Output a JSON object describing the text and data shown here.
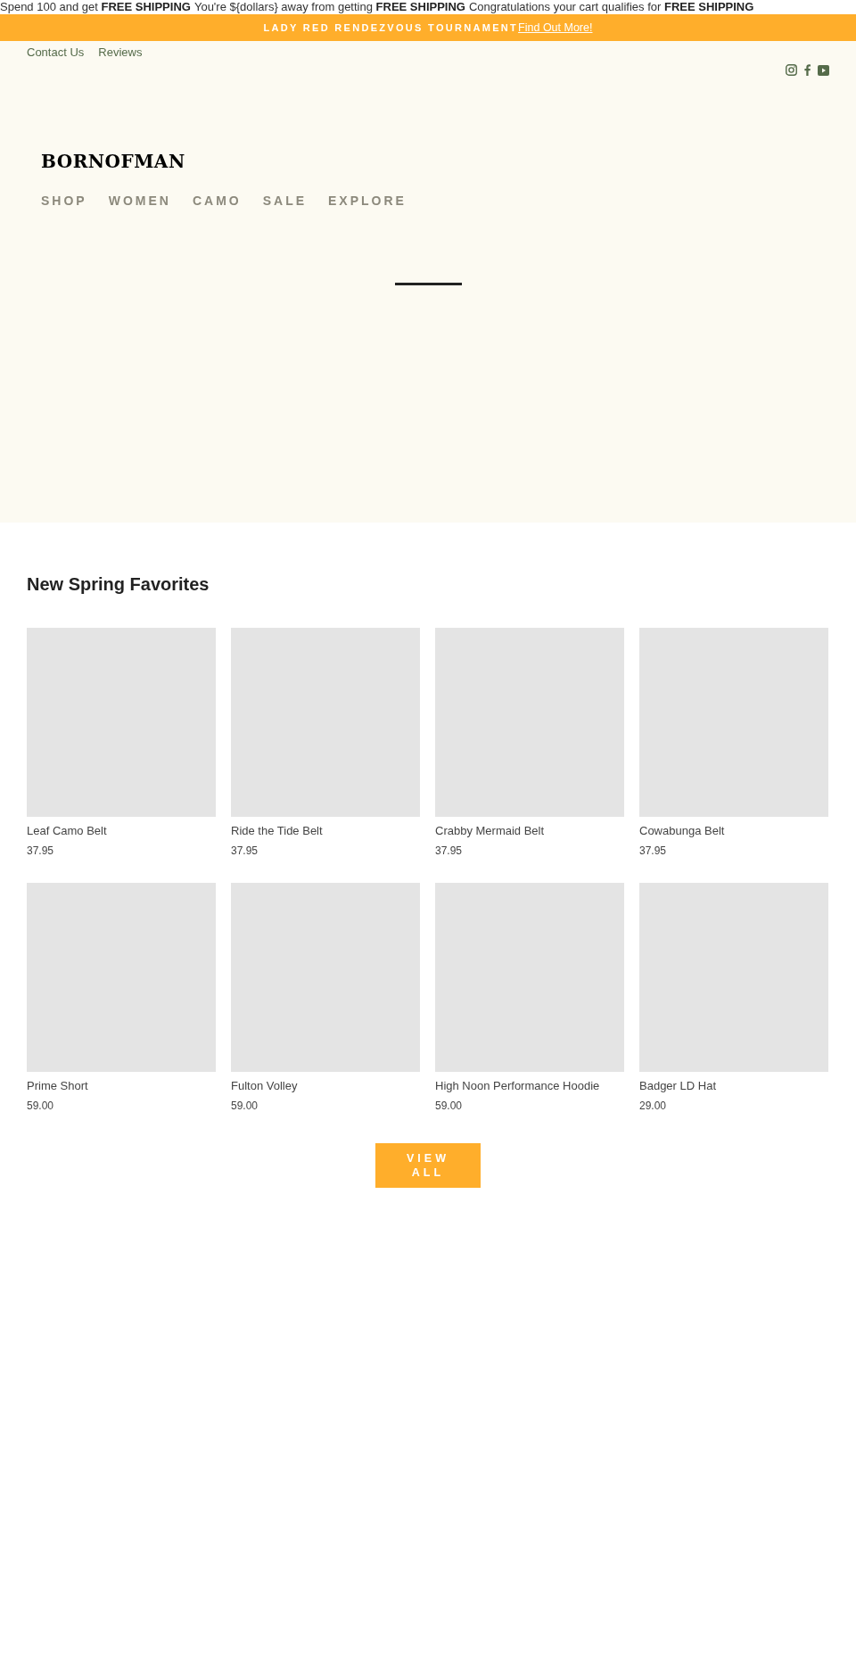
{
  "shipping_messages": [
    "Spend 100 and get **FREE SHIPPING**",
    "You're ${dollars} away from getting **FREE SHIPPING**",
    "Congratulations your cart qualifies for **FREE SHIPPING**"
  ],
  "announcement": {
    "text": "LADY RED RENDEZVOUS TOURNAMENT",
    "link": "Find Out More!"
  },
  "top_links": [
    "Contact Us",
    "Reviews"
  ],
  "social_icons": [
    {
      "kind": "instagram"
    },
    {
      "kind": "facebook"
    },
    {
      "kind": "youtube"
    }
  ],
  "logo": "BORNOFMAN",
  "nav": [
    "SHOP",
    "WOMEN",
    "CAMO",
    "SALE",
    "EXPLORE"
  ],
  "section_title": "New Spring Favorites",
  "products": [
    {
      "name": "Leaf Camo Belt",
      "price": "37.95"
    },
    {
      "name": "Ride the Tide Belt",
      "price": "37.95"
    },
    {
      "name": "Crabby Mermaid Belt",
      "price": "37.95"
    },
    {
      "name": "Cowabunga Belt",
      "price": "37.95"
    },
    {
      "name": "Prime Short",
      "price": "59.00"
    },
    {
      "name": "Fulton Volley",
      "price": "59.00"
    },
    {
      "name": "High Noon Performance Hoodie",
      "price": "59.00"
    },
    {
      "name": "Badger LD Hat",
      "price": "29.00"
    }
  ],
  "view_all": "VIEW ALL"
}
